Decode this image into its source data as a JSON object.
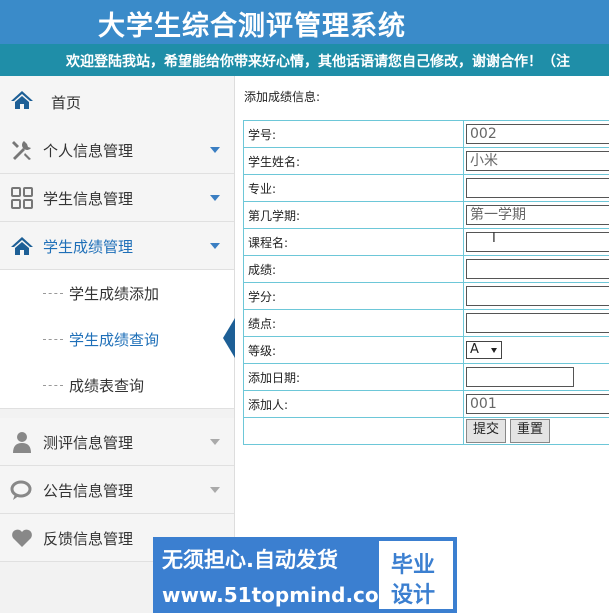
{
  "app": {
    "title": "大学生综合测评管理系统"
  },
  "marquee": "欢迎登陆我站，希望能给你带来好心情，其他话语请您自己修改，谢谢合作！（注",
  "sidebar": {
    "items": [
      {
        "label": "首页",
        "icon": "home-icon"
      },
      {
        "label": "个人信息管理",
        "icon": "tools-icon"
      },
      {
        "label": "学生信息管理",
        "icon": "grid-icon"
      },
      {
        "label": "学生成绩管理",
        "icon": "home-icon"
      },
      {
        "label": "测评信息管理",
        "icon": "user-icon"
      },
      {
        "label": "公告信息管理",
        "icon": "chat-icon"
      },
      {
        "label": "反馈信息管理",
        "icon": "heart-icon"
      }
    ],
    "sub": [
      "学生成绩添加",
      "学生成绩查询",
      "成绩表查询"
    ]
  },
  "form": {
    "caption": "添加成绩信息:",
    "rows": [
      {
        "label": "学号:",
        "value": "002"
      },
      {
        "label": "学生姓名:",
        "value": "小米"
      },
      {
        "label": "专业:",
        "value": ""
      },
      {
        "label": "第几学期:",
        "value": "第一学期"
      },
      {
        "label": "课程名:",
        "value": ""
      },
      {
        "label": "成绩:",
        "value": ""
      },
      {
        "label": "学分:",
        "value": ""
      },
      {
        "label": "绩点:",
        "value": ""
      },
      {
        "label": "等级:",
        "value": "A"
      },
      {
        "label": "添加日期:",
        "value": ""
      },
      {
        "label": "添加人:",
        "value": "001"
      }
    ],
    "submit": "提交",
    "reset": "重置"
  },
  "watermark": {
    "line1": "无须担心.自动发货",
    "line2": "www.51topmind.com",
    "badge1": "毕业",
    "badge2": "设计"
  },
  "colors": {
    "header": "#3a8bc9",
    "marquee": "#1f8ea8",
    "accent": "#1e6fb8",
    "table_border": "#6dc7d8"
  }
}
